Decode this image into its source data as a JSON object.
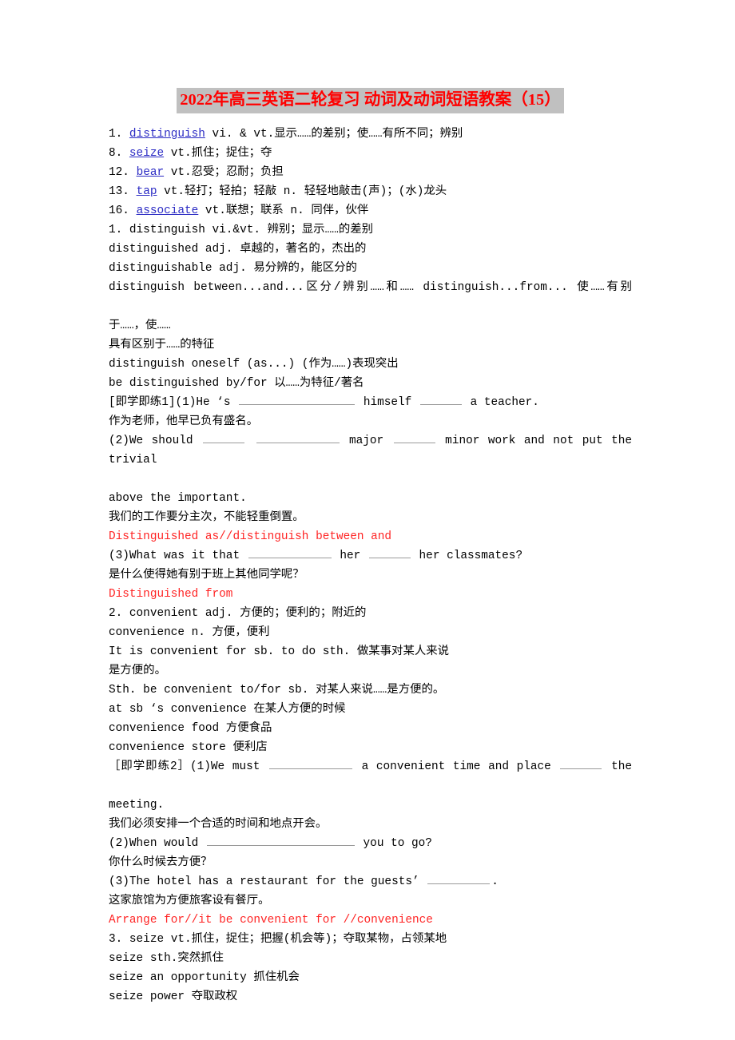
{
  "document": {
    "title": "2022年高三英语二轮复习 动词及动词短语教案（15）",
    "title_text_color": "#ff0000",
    "title_highlight_color": "#c0c0c0",
    "link_color": "#2b2bc4",
    "answer_color": "#ff2424",
    "page_background": "#ffffff"
  },
  "vocab_list": [
    {
      "num": "1.",
      "word": "distinguish",
      "definition": " vi. & vt.显示……的差别；使……有所不同；辨别"
    },
    {
      "num": "8.",
      "word": "seize",
      "definition": " vt.抓住；捉住；夺"
    },
    {
      "num": "12.",
      "word": "bear",
      "definition": " vt.忍受；忍耐；负担"
    },
    {
      "num": "13.",
      "word": "tap",
      "definition": " vt.轻打；轻拍；轻敲 n. 轻轻地敲击(声)；(水)龙头"
    },
    {
      "num": "16.",
      "word": "associate",
      "definition": " vt.联想；联系 n. 同伴，伙伴"
    }
  ],
  "entry1": {
    "headword": "1. distinguish vi.&vt. 辨别；显示……的差别",
    "forms": [
      "distinguished adj. 卓越的，著名的，杰出的",
      "distinguishable adj. 易分辨的，能区分的"
    ],
    "phrase_line": "distinguish between...and...区分/辨别……和…… distinguish...from... 使……有别于……，使……",
    "phrase_line_part1": "distinguish between...and...区分/辨别……和…… distinguish...from... 使……有别",
    "phrase_line_part2": "于……，使……",
    "feature_line": "具有区别于……的特征",
    "oneself_line": "distinguish oneself (as...) (作为……)表现突出",
    "bydfor_line": "be distinguished by/for 以……为特征/著名",
    "exercise_label": "[即学即练1]",
    "q1_a": "(1)He ‘s ",
    "q1_b": " himself ",
    "q1_c": " a teacher.",
    "q1_translation": "作为老师，他早已负有盛名。",
    "q2_a": "(2)We should ",
    "q2_b": " ",
    "q2_c": " major ",
    "q2_d": " minor work and not put the trivial",
    "q2_cont": "above the important.",
    "q2_translation": "我们的工作要分主次，不能轻重倒置。",
    "answer1": "Distinguished as//distinguish between and",
    "q3_a": "(3)What was it that ",
    "q3_b": " her ",
    "q3_c": " her classmates?",
    "q3_translation": "是什么使得她有别于班上其他同学呢？",
    "answer2": "Distinguished from"
  },
  "entry2": {
    "headword": "2. convenient adj. 方便的；便利的；附近的",
    "noun_form": "convenience n. 方便，便利",
    "usage": [
      "It is convenient for sb. to do sth. 做某事对某人来说",
      "是方便的。",
      "Sth. be convenient to/for sb. 对某人来说……是方便的。",
      "at sb ‘s convenience 在某人方便的时候",
      "convenience food 方便食品",
      "convenience store 便利店"
    ],
    "exercise_label": "［即学即练2］",
    "q1_a": "(1)We must ",
    "q1_b": " a convenient time and place ",
    "q1_c": " the",
    "q1_cont": "meeting.",
    "q1_translation": "我们必须安排一个合适的时间和地点开会。",
    "q2_a": "(2)When would ",
    "q2_b": " you to go?",
    "q2_translation": "你什么时候去方便？",
    "q3_a": "(3)The hotel has a restaurant for the guests’ ",
    "q3_b": ".",
    "q3_translation": "这家旅馆为方便旅客设有餐厅。",
    "answer": "Arrange for//it be convenient for //convenience"
  },
  "entry3": {
    "headword": "3. seize vt.抓住，捉住；把握(机会等)；夺取某物，占领某地",
    "phrases": [
      "seize sth.突然抓住",
      "seize an opportunity 抓住机会",
      "seize power 夺取政权"
    ]
  }
}
